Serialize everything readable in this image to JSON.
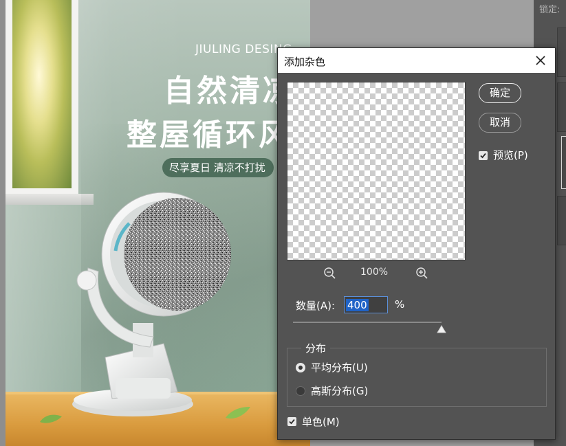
{
  "canvas": {
    "brand": "JIULING DESING",
    "headline_line1": "自然清凉",
    "headline_line2": "整屋循环风",
    "slogan": "尽享夏日 清凉不打扰"
  },
  "right_panel": {
    "lock_label": "锁定:"
  },
  "dialog": {
    "title": "添加杂色",
    "ok_label": "确定",
    "cancel_label": "取消",
    "preview_label": "预览(P)",
    "preview_checked": true,
    "zoom_level": "100%",
    "amount_label": "数量(A):",
    "amount_value": "400",
    "amount_unit": "%",
    "amount_slider_fraction": 1.0,
    "distribution_legend": "分布",
    "distribution_options": [
      {
        "label": "平均分布(U)",
        "selected": true
      },
      {
        "label": "高斯分布(G)",
        "selected": false
      }
    ],
    "monochrome_label": "单色(M)",
    "monochrome_checked": true
  },
  "icons": {
    "close": "close-icon",
    "zoom_out": "zoom-out-icon",
    "zoom_in": "zoom-in-icon",
    "checkmark": "checkmark-icon",
    "slider": "slider-triangle-icon"
  },
  "colors": {
    "dialog_bg": "#535353",
    "selection": "#1f63c7",
    "wall_green": "#86a392",
    "table_orange": "#d99b3e"
  }
}
